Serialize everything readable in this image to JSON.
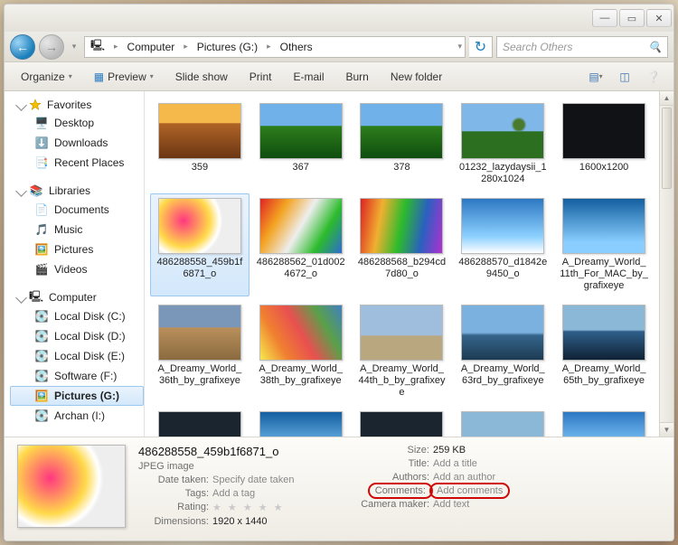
{
  "breadcrumb": {
    "root": "Computer",
    "loc": "Pictures (G:)",
    "folder": "Others"
  },
  "search": {
    "placeholder": "Search Others"
  },
  "toolbar": {
    "organize": "Organize",
    "preview": "Preview",
    "slideshow": "Slide show",
    "print": "Print",
    "email": "E-mail",
    "burn": "Burn",
    "newfolder": "New folder"
  },
  "nav": {
    "favorites": {
      "label": "Favorites",
      "items": [
        "Desktop",
        "Downloads",
        "Recent Places"
      ]
    },
    "libraries": {
      "label": "Libraries",
      "items": [
        "Documents",
        "Music",
        "Pictures",
        "Videos"
      ]
    },
    "computer": {
      "label": "Computer",
      "items": [
        "Local Disk (C:)",
        "Local Disk (D:)",
        "Local Disk (E:)",
        "Software (F:)",
        "Pictures (G:)",
        "Archan (I:)"
      ]
    }
  },
  "grid": [
    {
      "name": "359",
      "preset": "p-sunset"
    },
    {
      "name": "367",
      "preset": "p-green"
    },
    {
      "name": "378",
      "preset": "p-green"
    },
    {
      "name": "01232_lazydaysii_1280x1024",
      "preset": "p-field"
    },
    {
      "name": "1600x1200",
      "preset": "p-dark"
    },
    {
      "name": "486288558_459b1f6871_o",
      "preset": "p-abstract",
      "selected": true
    },
    {
      "name": "486288562_01d0024672_o",
      "preset": "p-rainbow1"
    },
    {
      "name": "486288568_b294cd7d80_o",
      "preset": "p-rainbow2"
    },
    {
      "name": "486288570_d1842e9450_o",
      "preset": "p-sky1"
    },
    {
      "name": "A_Dreamy_World_11th_For_MAC_by_grafixeye",
      "preset": "p-sky2"
    },
    {
      "name": "A_Dreamy_World_36th_by_grafixeye",
      "preset": "p-colosseum"
    },
    {
      "name": "A_Dreamy_World_38th_by_grafixeye",
      "preset": "p-rainbow3"
    },
    {
      "name": "A_Dreamy_World_44th_b_by_grafixeye",
      "preset": "p-pisa"
    },
    {
      "name": "A_Dreamy_World_63rd_by_grafixeye",
      "preset": "p-mountain"
    },
    {
      "name": "A_Dreamy_World_65th_by_grafixeye",
      "preset": "p-shore"
    },
    {
      "name": "",
      "preset": "p-planet"
    },
    {
      "name": "",
      "preset": "p-sky2"
    },
    {
      "name": "",
      "preset": "p-planet"
    },
    {
      "name": "",
      "preset": "p-shore"
    },
    {
      "name": "",
      "preset": "p-sky1"
    }
  ],
  "details": {
    "filename": "486288558_459b1f6871_o",
    "filetype": "JPEG image",
    "labels": {
      "date": "Date taken:",
      "tags": "Tags:",
      "rating": "Rating:",
      "dimensions": "Dimensions:",
      "size": "Size:",
      "title": "Title:",
      "authors": "Authors:",
      "comments": "Comments:",
      "camera": "Camera maker:"
    },
    "values": {
      "date": "Specify date taken",
      "tags": "Add a tag",
      "rating": "★ ★ ★ ★ ★",
      "dimensions": "1920 x 1440",
      "size": "259 KB",
      "title": "Add a title",
      "authors": "Add an author",
      "comments": "Add comments",
      "camera": "Add text"
    }
  }
}
